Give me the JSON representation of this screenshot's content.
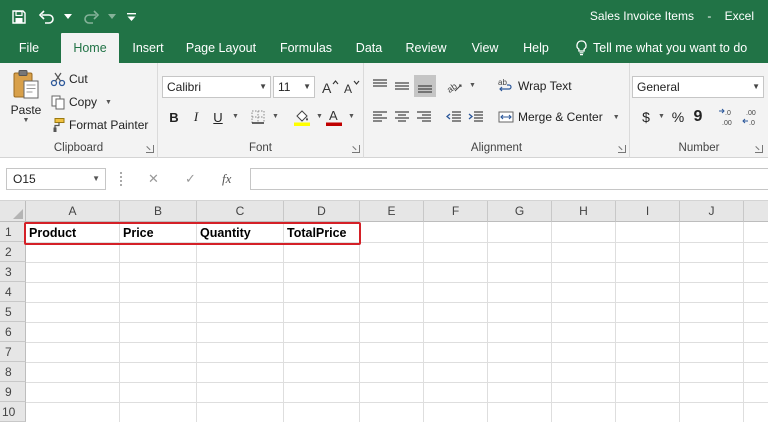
{
  "window": {
    "title": "Sales Invoice Items",
    "app": "Excel"
  },
  "quick_access": {
    "save": "save-icon",
    "undo": "undo-icon",
    "redo": "redo-icon",
    "customize": "customize-qat-icon"
  },
  "tabs": [
    "File",
    "Home",
    "Insert",
    "Page Layout",
    "Formulas",
    "Data",
    "Review",
    "View",
    "Help"
  ],
  "active_tab": "Home",
  "tell_me": "Tell me what you want to do",
  "ribbon": {
    "clipboard": {
      "label": "Clipboard",
      "paste": "Paste",
      "cut": "Cut",
      "copy": "Copy",
      "format_painter": "Format Painter"
    },
    "font": {
      "label": "Font",
      "font_name": "Calibri",
      "font_size": "11",
      "bold": "B",
      "italic": "I",
      "underline": "U",
      "fill_color": "#ffff00",
      "font_color": "#c00000"
    },
    "alignment": {
      "label": "Alignment",
      "wrap_text": "Wrap Text",
      "merge_center": "Merge & Center"
    },
    "number": {
      "label": "Number",
      "format": "General",
      "currency": "$",
      "percent": "%",
      "comma": "9"
    }
  },
  "formula_bar": {
    "name_box": "O15",
    "fx": "fx",
    "content": ""
  },
  "sheet": {
    "columns": [
      "A",
      "B",
      "C",
      "D",
      "E",
      "F",
      "G",
      "H",
      "I",
      "J"
    ],
    "rows": [
      "1",
      "2",
      "3",
      "4",
      "5",
      "6",
      "7",
      "8",
      "9",
      "10"
    ],
    "cells": {
      "A1": "Product",
      "B1": "Price",
      "C1": "Quantity",
      "D1": "TotalPrice"
    },
    "highlight_color": "#d42027"
  },
  "colors": {
    "brand": "#217346",
    "ribbon_bg": "#f3f3f3"
  }
}
